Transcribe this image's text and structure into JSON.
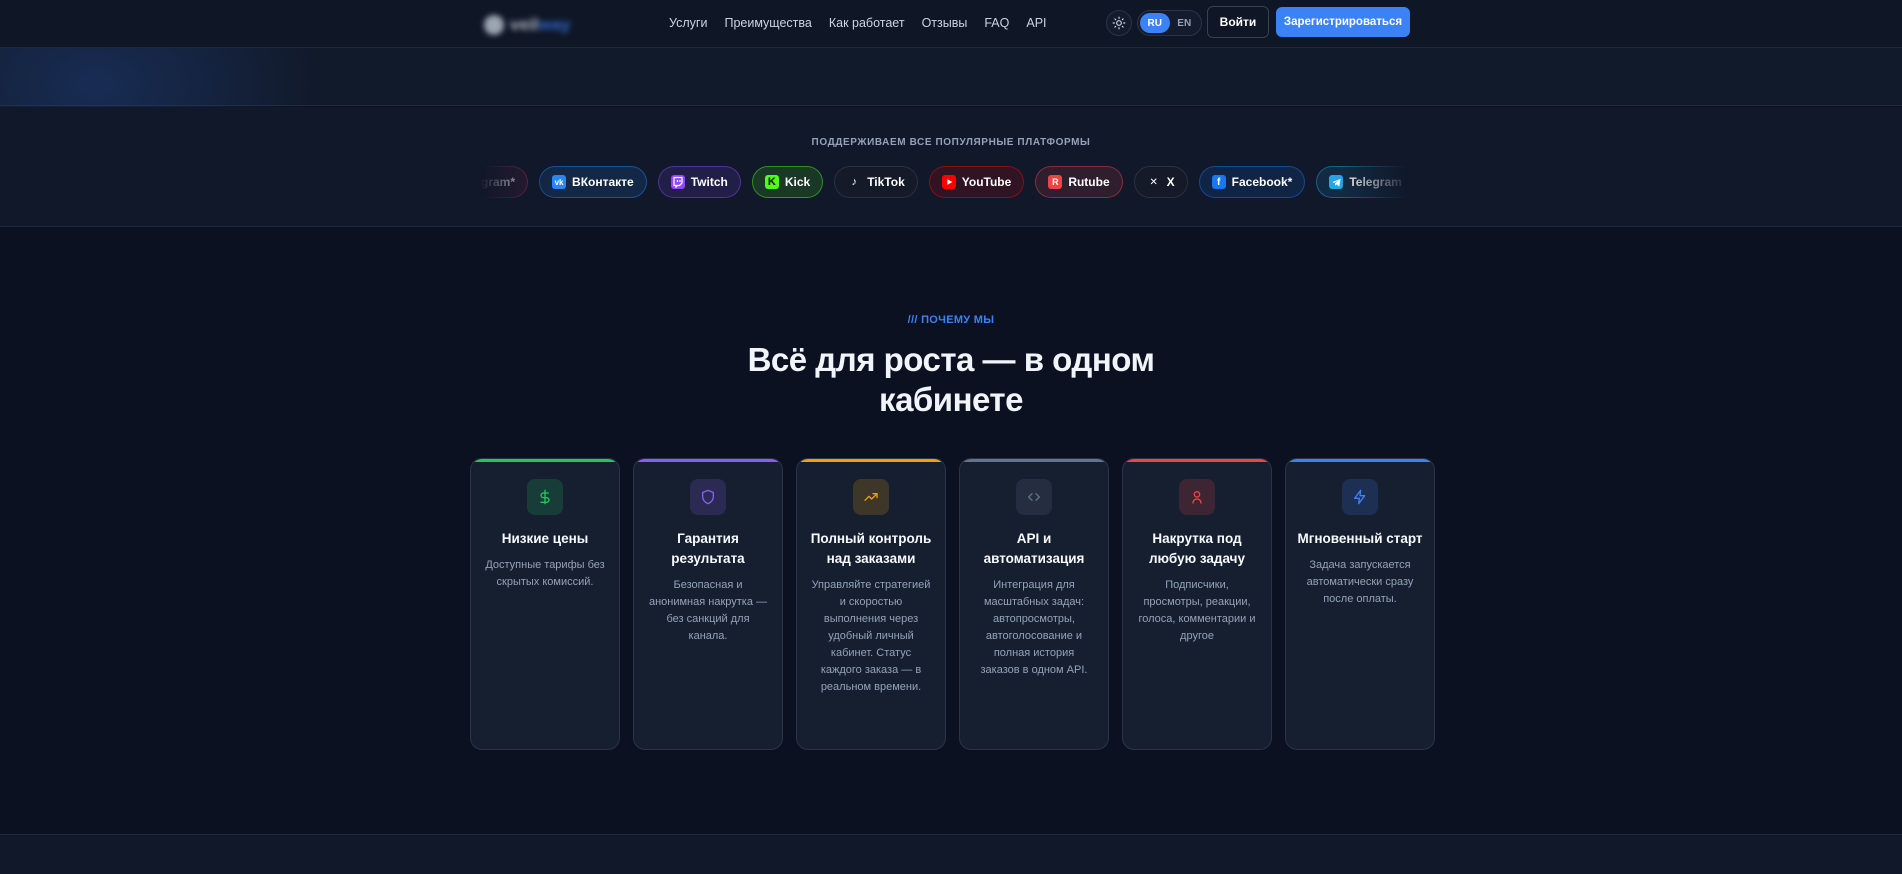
{
  "brand": {
    "name_part1": "veil",
    "name_part2": "way"
  },
  "nav": {
    "links": [
      "Услуги",
      "Преимущества",
      "Как работает",
      "Отзывы",
      "FAQ",
      "API"
    ],
    "theme_icon": "sun-icon",
    "lang": {
      "ru": "RU",
      "en": "EN",
      "active": "RU"
    },
    "login_label": "Войти",
    "register_label": "Зарегистрироваться"
  },
  "platforms": {
    "title": "ПОДДЕРЖИВАЕМ ВСЕ ПОПУЛЯРНЫЕ ПЛАТФОРМЫ",
    "chips": [
      {
        "label": "Instagram*",
        "icon": "instagram-icon",
        "color": "#e1306c"
      },
      {
        "label": "ВКонтакте",
        "icon": "vk-icon",
        "color": "#2787f5"
      },
      {
        "label": "Twitch",
        "icon": "twitch-icon",
        "color": "#9146ff"
      },
      {
        "label": "Kick",
        "icon": "kick-icon",
        "color": "#53fc18"
      },
      {
        "label": "TikTok",
        "icon": "tiktok-icon",
        "color": "#1f2937"
      },
      {
        "label": "YouTube",
        "icon": "youtube-icon",
        "color": "#ff0000"
      },
      {
        "label": "Rutube",
        "icon": "rutube-icon",
        "color": "#ef4444"
      },
      {
        "label": "X",
        "icon": "x-icon",
        "color": "#1f2937"
      },
      {
        "label": "Facebook*",
        "icon": "facebook-icon",
        "color": "#1877f2"
      },
      {
        "label": "Telegram",
        "icon": "telegram-icon",
        "color": "#26a5e4"
      }
    ]
  },
  "why": {
    "eyebrow": "/// ПОЧЕМУ МЫ",
    "headline_line1": "Всё для роста — в одном",
    "headline_line2": "кабинете",
    "cards": [
      {
        "title": "Низкие цены",
        "text": "Доступные тарифы без скрытых комиссий.",
        "icon": "dollar-icon",
        "color": "#22c55e"
      },
      {
        "title": "Гарантия результата",
        "text": "Безопасная и анонимная накрутка — без санкций для канала.",
        "icon": "shield-icon",
        "color": "#8b5cf6"
      },
      {
        "title": "Полный контроль над заказами",
        "text": "Управляйте стратегией и скоростью выполнения через удобный личный кабинет. Статус каждого заказа — в реальном времени.",
        "icon": "trending-up-icon",
        "color": "#f59e0b"
      },
      {
        "title": "API и автоматизация",
        "text": "Интеграция для масштабных задач: автопросмотры, автоголосование и полная история заказов в одном API.",
        "icon": "code-icon",
        "color": "#64748b"
      },
      {
        "title": "Накрутка под любую задачу",
        "text": "Подписчики, просмотры, реакции, голоса, комментарии и другое",
        "icon": "user-icon",
        "color": "#ef4444"
      },
      {
        "title": "Мгновенный старт",
        "text": "Задача запускается автоматически сразу после оплаты.",
        "icon": "lightning-icon",
        "color": "#3b82f6"
      }
    ]
  }
}
